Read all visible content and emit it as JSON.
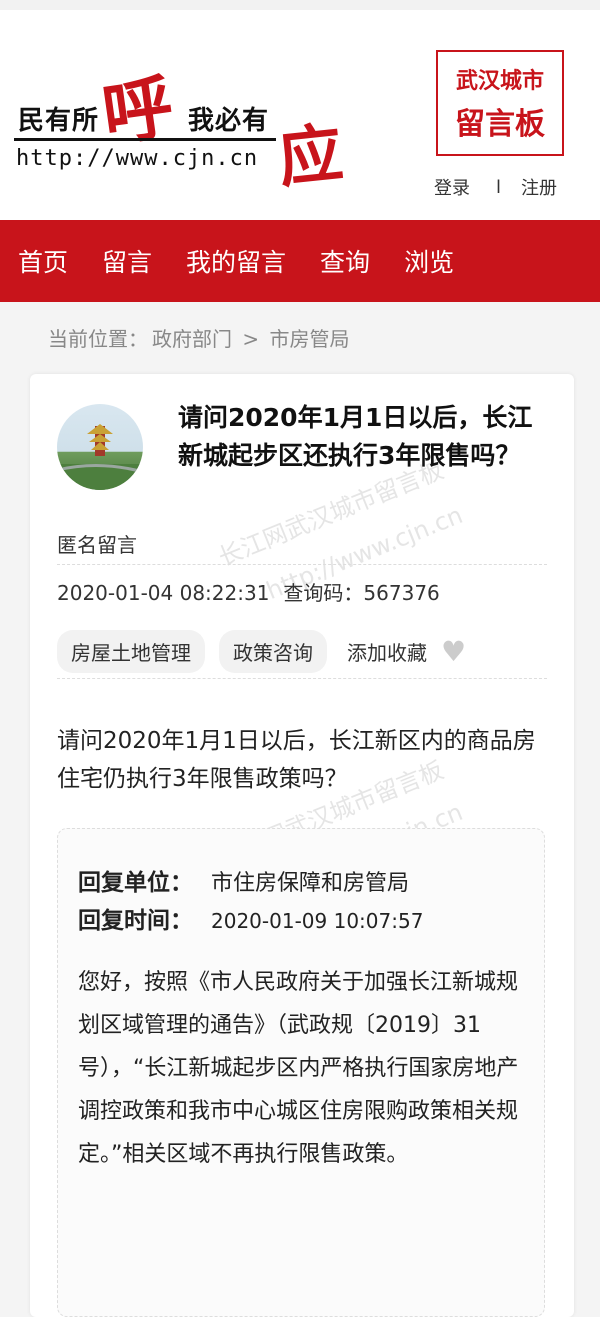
{
  "header": {
    "logo_left": "民有所",
    "logo_hu": "呼",
    "logo_right": "我必有",
    "logo_ying": "应",
    "logo_url": "http://www.cjn.cn",
    "board_line1": "武汉城市",
    "board_line2": "留言板",
    "login": "登录",
    "separator": "l",
    "register": "注册"
  },
  "nav": {
    "items": [
      "首页",
      "留言",
      "我的留言",
      "查询",
      "浏览"
    ]
  },
  "breadcrumb": {
    "prefix": "当前位置：",
    "level1": "政府部门",
    "arrow": ">",
    "level2": "市房管局"
  },
  "question": {
    "title": "请问2020年1月1日以后，长江新城起步区还执行3年限售吗？",
    "author": "匿名留言",
    "datetime": "2020-01-04 08:22:31",
    "code_label": "查询码：",
    "code": "567376",
    "tags": [
      "房屋土地管理",
      "政策咨询"
    ],
    "favorite_label": "添加收藏",
    "body": "请问2020年1月1日以后，长江新区内的商品房住宅仍执行3年限售政策吗？"
  },
  "reply": {
    "unit_label": "回复单位：",
    "unit": "市住房保障和房管局",
    "time_label": "回复时间：",
    "time": "2020-01-09 10:07:57",
    "text": "您好，按照《市人民政府关于加强长江新城规划区域管理的通告》（武政规〔2019〕31号），“长江新城起步区内严格执行国家房地产调控政策和我市中心城区住房限购政策相关规定。”相关区域不再执行限售政策。"
  },
  "watermark": {
    "line1": "长江网武汉城市留言板",
    "line2": "http://www.cjn.cn"
  },
  "colors": {
    "brand_red": "#c8141b"
  }
}
